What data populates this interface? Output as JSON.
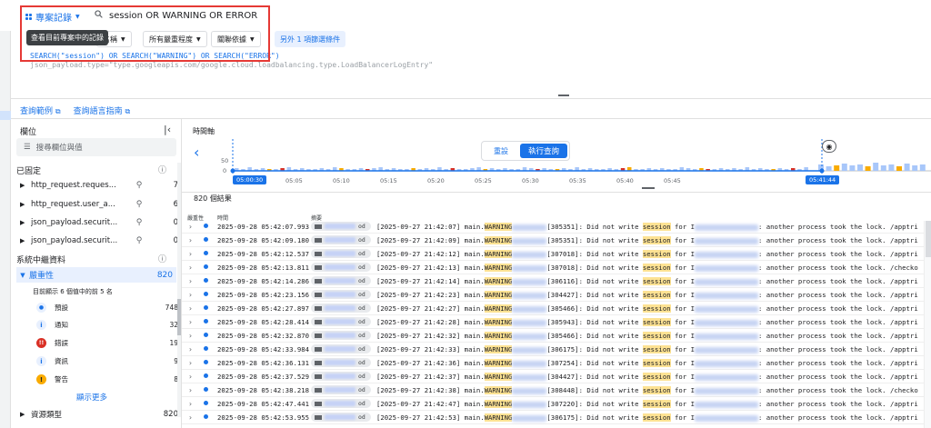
{
  "scope": {
    "label": "專案記錄"
  },
  "search": {
    "query": "session OR WARNING OR ERROR"
  },
  "tooltip": {
    "text": "查看目前專案中的記錄"
  },
  "chips": {
    "resource": "名稱",
    "severity": "所有嚴重程度",
    "correlate": "關聯依據",
    "more": "另外 1 項篩選條件"
  },
  "query": {
    "line1": "SEARCH(\"session\") OR SEARCH(\"WARNING\") OR SEARCH(\"ERROR\")",
    "line2": "json_payload.type=\"type.googleapis.com/google.cloud.loadbalancing.type.LoadBalancerLogEntry\""
  },
  "links": {
    "examples": "查詢範例",
    "guide": "查詢語言指南"
  },
  "fields_panel": {
    "title": "欄位",
    "search_placeholder": "搜尋欄位與值",
    "pinned_label": "已固定",
    "pinned": [
      {
        "name": "http_request.reques...",
        "count": "7"
      },
      {
        "name": "http_request.user_a...",
        "count": "6"
      },
      {
        "name": "json_payload.securit...",
        "count": "0"
      },
      {
        "name": "json_payload.securit...",
        "count": "0"
      }
    ],
    "metadata_label": "系統中繼資料",
    "severity_label": "嚴重性",
    "severity_count": "820",
    "shown_note": "目前顯示 6 個值中的前 5 名",
    "severities": [
      {
        "label": "預設",
        "count": "748",
        "color": "#1a73e8",
        "glyph": "●"
      },
      {
        "label": "通知",
        "count": "32",
        "color": "#1a73e8",
        "glyph": "i"
      },
      {
        "label": "錯誤",
        "count": "19",
        "color": "#d93025",
        "glyph": "!!"
      },
      {
        "label": "資訊",
        "count": "9",
        "color": "#1a73e8",
        "glyph": "i"
      },
      {
        "label": "警告",
        "count": "8",
        "color": "#f9ab00",
        "glyph": "!"
      }
    ],
    "show_more": "顯示更多",
    "resource_type_label": "資源類型",
    "resource_type_count": "820"
  },
  "histogram": {
    "title": "時間軸",
    "y_max": "50",
    "y_min": "0",
    "ticks": [
      "05:05",
      "05:10",
      "05:15",
      "05:20",
      "05:25",
      "05:30",
      "05:35",
      "05:40",
      "05:45"
    ],
    "start": "05:00:30",
    "end": "05:41:44",
    "reset": "重設",
    "run": "執行查詢"
  },
  "results": {
    "count": "820 個結果",
    "col_severity": "嚴重性",
    "col_time": "時間",
    "col_summary": "摘要",
    "rows": [
      {
        "ts": "2025-09-28 05:42:07.993",
        "inner": "[2025-09-27 21:42:07]",
        "pid": "[305351]",
        "tail": ": another process took the lock. /apptri"
      },
      {
        "ts": "2025-09-28 05:42:09.180",
        "inner": "[2025-09-27 21:42:09]",
        "pid": "[305351]",
        "tail": ": another process took the lock. /apptri"
      },
      {
        "ts": "2025-09-28 05:42:12.537",
        "inner": "[2025-09-27 21:42:12]",
        "pid": "[307018]",
        "tail": ": another process took the lock. /apptri"
      },
      {
        "ts": "2025-09-28 05:42:13.811",
        "inner": "[2025-09-27 21:42:13]",
        "pid": "[307018]",
        "tail": ": another process took the lock. /checko"
      },
      {
        "ts": "2025-09-28 05:42:14.286",
        "inner": "[2025-09-27 21:42:14]",
        "pid": "[306116]",
        "tail": ": another process took the lock. /apptri"
      },
      {
        "ts": "2025-09-28 05:42:23.156",
        "inner": "[2025-09-27 21:42:23]",
        "pid": "[304427]",
        "tail": ": another process took the lock. /apptri"
      },
      {
        "ts": "2025-09-28 05:42:27.897",
        "inner": "[2025-09-27 21:42:27]",
        "pid": "[305466]",
        "tail": ": another process took the lock. /apptri"
      },
      {
        "ts": "2025-09-28 05:42:28.414",
        "inner": "[2025-09-27 21:42:28]",
        "pid": "[305943]",
        "tail": ": another process took the lock. /apptri"
      },
      {
        "ts": "2025-09-28 05:42:32.870",
        "inner": "[2025-09-27 21:42:32]",
        "pid": "[305466]",
        "tail": ": another process took the lock. /apptri"
      },
      {
        "ts": "2025-09-28 05:42:33.984",
        "inner": "[2025-09-27 21:42:33]",
        "pid": "[306175]",
        "tail": ": another process took the lock. /apptri"
      },
      {
        "ts": "2025-09-28 05:42:36.131",
        "inner": "[2025-09-27 21:42:36]",
        "pid": "[307254]",
        "tail": ": another process took the lock. /apptri"
      },
      {
        "ts": "2025-09-28 05:42:37.529",
        "inner": "[2025-09-27 21:42:37]",
        "pid": "[304427]",
        "tail": ": another process took the lock. /apptri"
      },
      {
        "ts": "2025-09-28 05:42:38.218",
        "inner": "[2025-09-27 21:42:38]",
        "pid": "[308448]",
        "tail": ": another process took the lock. /checko"
      },
      {
        "ts": "2025-09-28 05:42:47.441",
        "inner": "[2025-09-27 21:42:47]",
        "pid": "[307220]",
        "tail": ": another process took the lock. /apptri"
      },
      {
        "ts": "2025-09-28 05:42:53.955",
        "inner": "[2025-09-27 21:42:53]",
        "pid": "[306175]",
        "tail": ": another process took the lock. /apptri"
      }
    ],
    "prefix": "main.",
    "level": "WARNING",
    "mid": ": Did not write ",
    "word": "session",
    "forw": " for I",
    "tag_suffix": "od"
  }
}
